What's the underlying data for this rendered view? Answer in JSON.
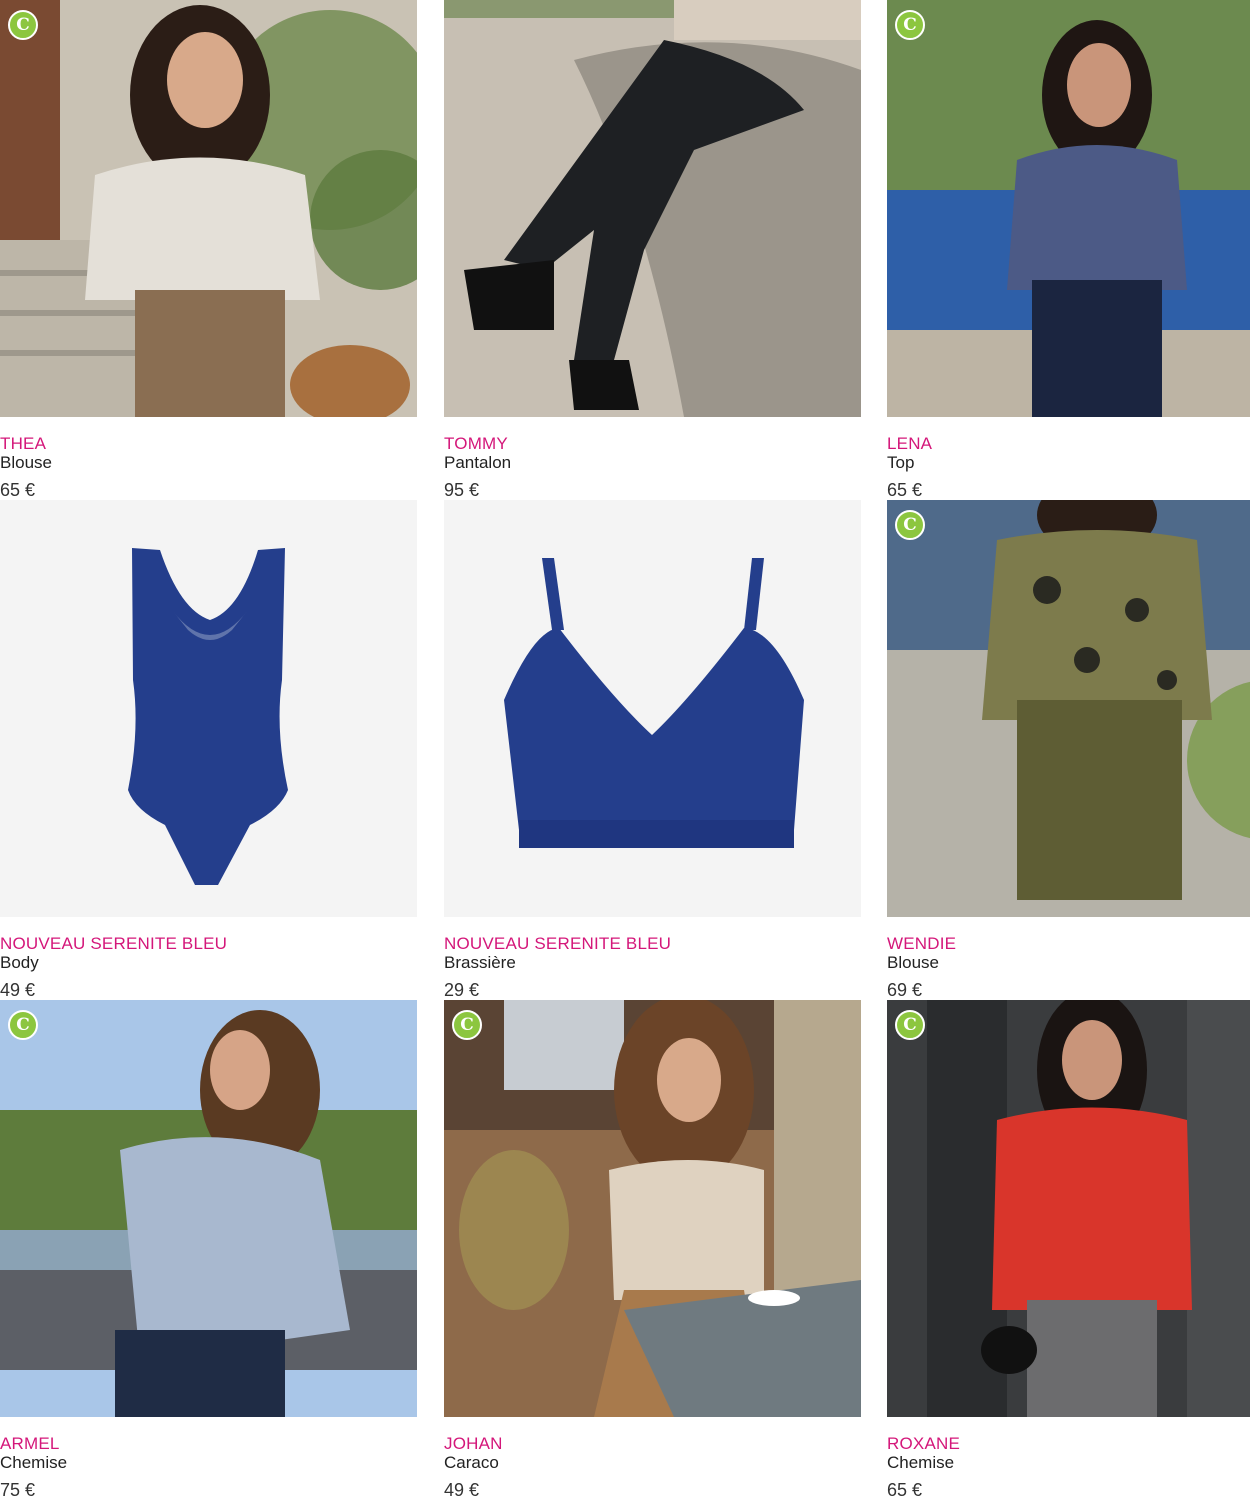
{
  "colors": {
    "accent": "#d4177a",
    "badge": "#8cc63f",
    "text": "#222222"
  },
  "badge_icon": "eco-leaf-icon",
  "products": [
    {
      "brand": "THEA",
      "type": "Blouse",
      "price": "65 €"
    },
    {
      "brand": "TOMMY",
      "type": "Pantalon",
      "price": "95 €"
    },
    {
      "brand": "LENA",
      "type": "Top",
      "price": "65 €"
    },
    {
      "brand": "NOUVEAU SERENITE BLEU",
      "type": "Body",
      "price": "49 €"
    },
    {
      "brand": "NOUVEAU SERENITE BLEU",
      "type": "Brassière",
      "price": "29 €"
    },
    {
      "brand": "WENDIE",
      "type": "Blouse",
      "price": "69 €"
    },
    {
      "brand": "ARMEL",
      "type": "Chemise",
      "price": "75 €"
    },
    {
      "brand": "JOHAN",
      "type": "Caraco",
      "price": "49 €"
    },
    {
      "brand": "ROXANE",
      "type": "Chemise",
      "price": "65 €"
    }
  ]
}
